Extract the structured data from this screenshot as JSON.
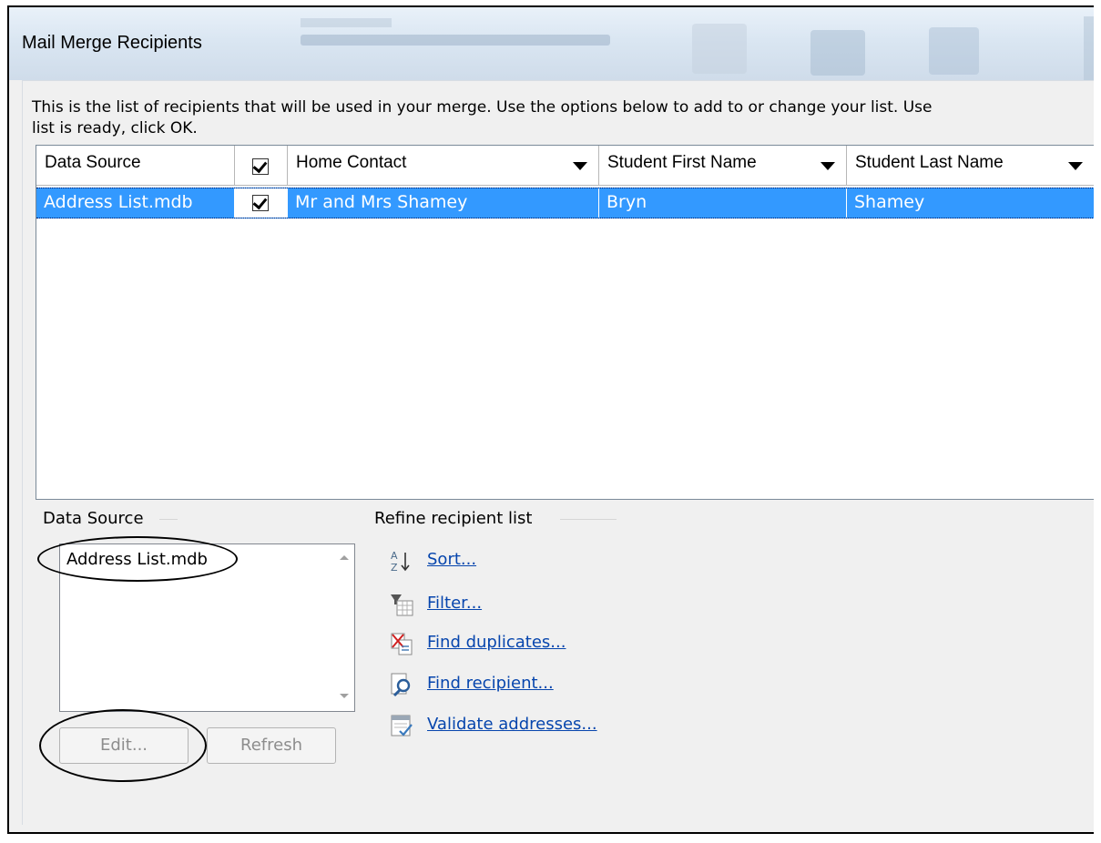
{
  "window": {
    "title": "Mail Merge Recipients"
  },
  "instructions": "This is the list of recipients that will be used in your merge.  Use the options below to add to or change your list.  Use\nlist is ready, click OK.",
  "grid": {
    "columns": [
      {
        "label": "Data Source",
        "dropdown": false
      },
      {
        "label": "",
        "checkbox": true,
        "checked": true
      },
      {
        "label": "Home Contact",
        "dropdown": true
      },
      {
        "label": "Student First Name",
        "dropdown": true
      },
      {
        "label": "Student Last Name",
        "dropdown": true
      }
    ],
    "rows": [
      {
        "source": "Address List.mdb",
        "checked": true,
        "home_contact": "Mr and Mrs Shamey",
        "first_name": "Bryn",
        "last_name": "Shamey",
        "selected": true
      }
    ]
  },
  "data_source": {
    "label": "Data Source",
    "items": [
      "Address List.mdb"
    ],
    "edit_label": "Edit...",
    "refresh_label": "Refresh"
  },
  "refine": {
    "label": "Refine recipient list",
    "items": [
      {
        "label": "Sort...",
        "icon": "sort-az-icon"
      },
      {
        "label": "Filter...",
        "icon": "filter-icon"
      },
      {
        "label": "Find duplicates...",
        "icon": "find-duplicates-icon"
      },
      {
        "label": "Find recipient...",
        "icon": "find-recipient-icon"
      },
      {
        "label": "Validate addresses...",
        "icon": "validate-addresses-icon"
      }
    ]
  },
  "colors": {
    "selection": "#3399ff",
    "link": "#0645ad",
    "panel": "#f0f0f0"
  }
}
